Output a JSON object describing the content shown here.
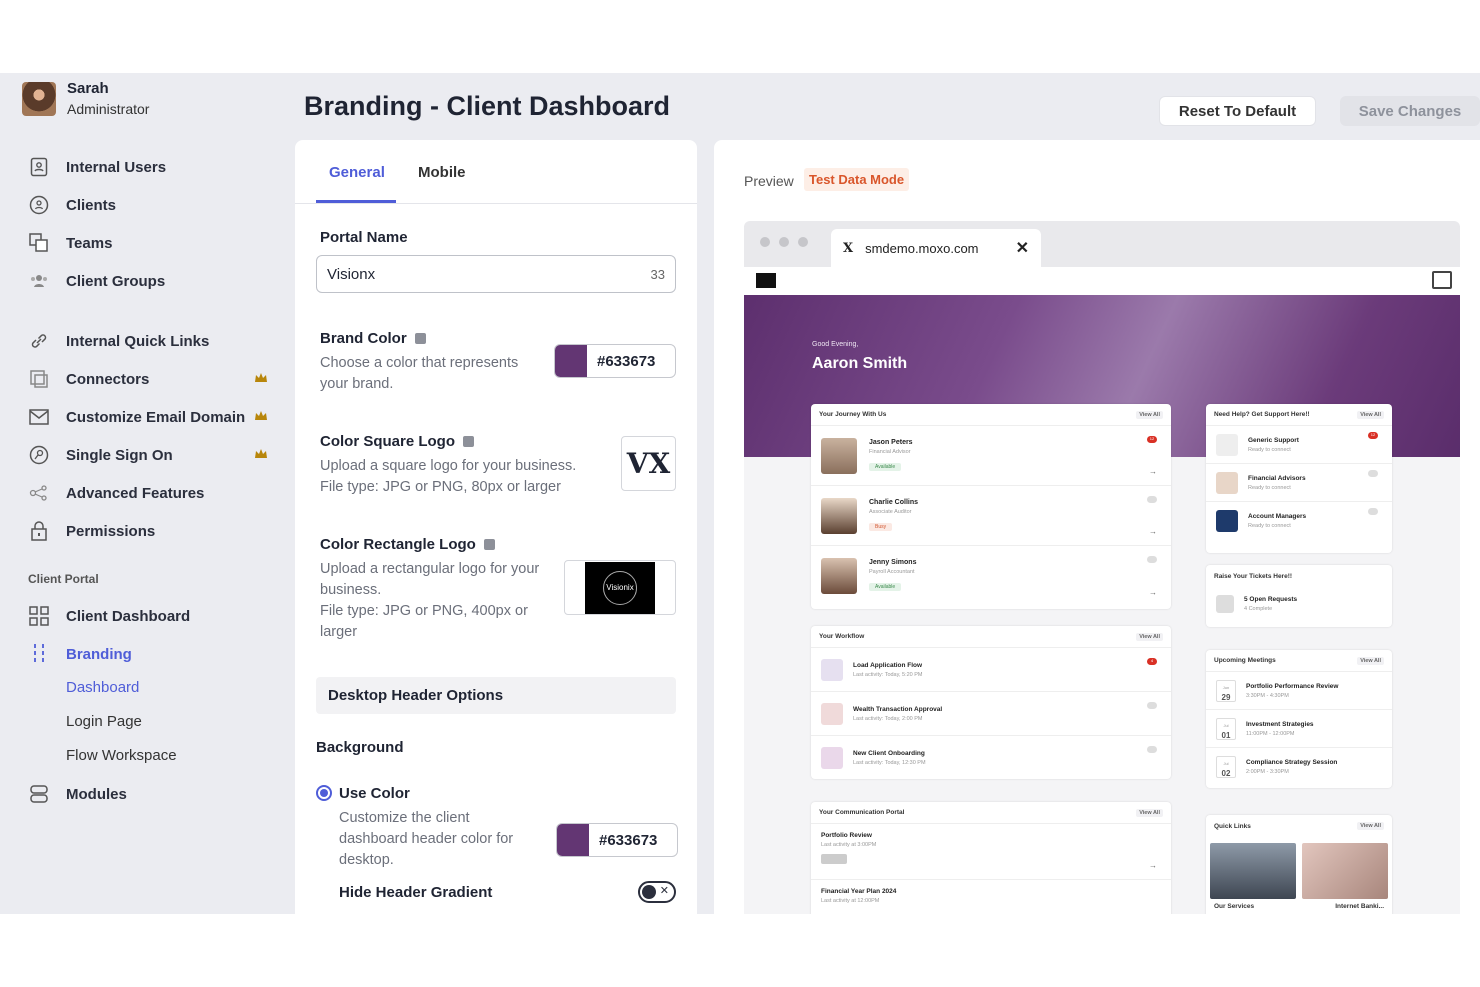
{
  "user": {
    "name": "Sarah",
    "role": "Administrator"
  },
  "nav": {
    "internal_users": "Internal Users",
    "clients": "Clients",
    "teams": "Teams",
    "client_groups": "Client Groups",
    "internal_quick_links": "Internal Quick Links",
    "connectors": "Connectors",
    "customize_email_domain": "Customize Email Domain",
    "single_sign_on": "Single Sign On",
    "advanced_features": "Advanced Features",
    "permissions": "Permissions",
    "section_client_portal": "Client Portal",
    "client_dashboard": "Client Dashboard",
    "branding": "Branding",
    "sub_dashboard": "Dashboard",
    "sub_login_page": "Login Page",
    "sub_flow_workspace": "Flow Workspace",
    "modules": "Modules"
  },
  "header": {
    "title": "Branding - Client Dashboard",
    "reset": "Reset To Default",
    "save": "Save Changes"
  },
  "settings": {
    "tabs": [
      "General",
      "Mobile"
    ],
    "portal_name_label": "Portal Name",
    "portal_name_value": "Visionx",
    "portal_name_count": "33",
    "brand_color_label": "Brand Color",
    "brand_color_desc": "Choose a color that represents your brand.",
    "brand_color_hex": "#633673",
    "square_logo_label": "Color Square Logo",
    "square_logo_desc1": "Upload a square logo for your business.",
    "square_logo_desc2": "File type: JPG or PNG, 80px or larger",
    "square_logo_mark": "VX",
    "rect_logo_label": "Color Rectangle Logo",
    "rect_logo_desc1": "Upload a rectangular logo for your business.",
    "rect_logo_desc2": "File type: JPG or PNG, 400px or larger",
    "rect_logo_mark": "Visionix",
    "desktop_header": "Desktop Header Options",
    "background_label": "Background",
    "use_color_label": "Use Color",
    "use_color_desc": "Customize the client dashboard header color for desktop.",
    "header_color_hex": "#633673",
    "hide_gradient_label": "Hide Header Gradient"
  },
  "preview": {
    "label": "Preview",
    "badge": "Test Data Mode",
    "url": "smdemo.moxo.com",
    "greeting": "Good Evening,",
    "client_name": "Aaron Smith",
    "journey": {
      "title": "Your Journey With Us",
      "view_all": "View All",
      "people": [
        {
          "name": "Jason Peters",
          "role": "Financial Advisor",
          "status": "Available",
          "badge": "12"
        },
        {
          "name": "Charlie Collins",
          "role": "Associate Auditor",
          "status": "Busy",
          "badge": ""
        },
        {
          "name": "Jenny Simons",
          "role": "Payroll Accountant",
          "status": "Available",
          "badge": ""
        }
      ]
    },
    "support": {
      "title": "Need Help? Get Support Here!!",
      "view_all": "View All",
      "items": [
        {
          "name": "Generic Support",
          "sub": "Ready to connect",
          "badge": "12"
        },
        {
          "name": "Financial Advisors",
          "sub": "Ready to connect",
          "badge": ""
        },
        {
          "name": "Account Managers",
          "sub": "Ready to connect",
          "badge": ""
        }
      ]
    },
    "tickets": {
      "title": "Raise Your Tickets Here!!",
      "name": "5 Open Requests",
      "sub": "4 Complete"
    },
    "workflow": {
      "title": "Your Workflow",
      "view_all": "View All",
      "items": [
        {
          "name": "Load Application Flow",
          "sub": "Last activity: Today, 5:20 PM",
          "badge": "4"
        },
        {
          "name": "Wealth Transaction Approval",
          "sub": "Last activity: Today, 2:00 PM",
          "badge": ""
        },
        {
          "name": "New Client Onboarding",
          "sub": "Last activity: Today, 12:30 PM",
          "badge": ""
        }
      ]
    },
    "meetings": {
      "title": "Upcoming Meetings",
      "view_all": "View All",
      "items": [
        {
          "month": "Jun",
          "day": "29",
          "name": "Portfolio Performance Review",
          "time": "3:30PM - 4:30PM"
        },
        {
          "month": "Jul",
          "day": "01",
          "name": "Investment Strategies",
          "time": "11:00PM - 12:00PM"
        },
        {
          "month": "Jul",
          "day": "02",
          "name": "Compliance Strategy Session",
          "time": "2:00PM - 3:30PM"
        }
      ]
    },
    "communication": {
      "title": "Your Communication Portal",
      "view_all": "View All",
      "items": [
        {
          "name": "Portfolio Review",
          "sub": "Last activity at 3:00PM"
        },
        {
          "name": "Financial Year Plan 2024",
          "sub": "Last activity at 12:00PM"
        }
      ]
    },
    "quick_links": {
      "title": "Quick Links",
      "view_all": "View All",
      "items": [
        "Our Services",
        "Internet Banki..."
      ]
    }
  },
  "colors": {
    "accent": "#4f5dd8",
    "brand": "#633673"
  }
}
